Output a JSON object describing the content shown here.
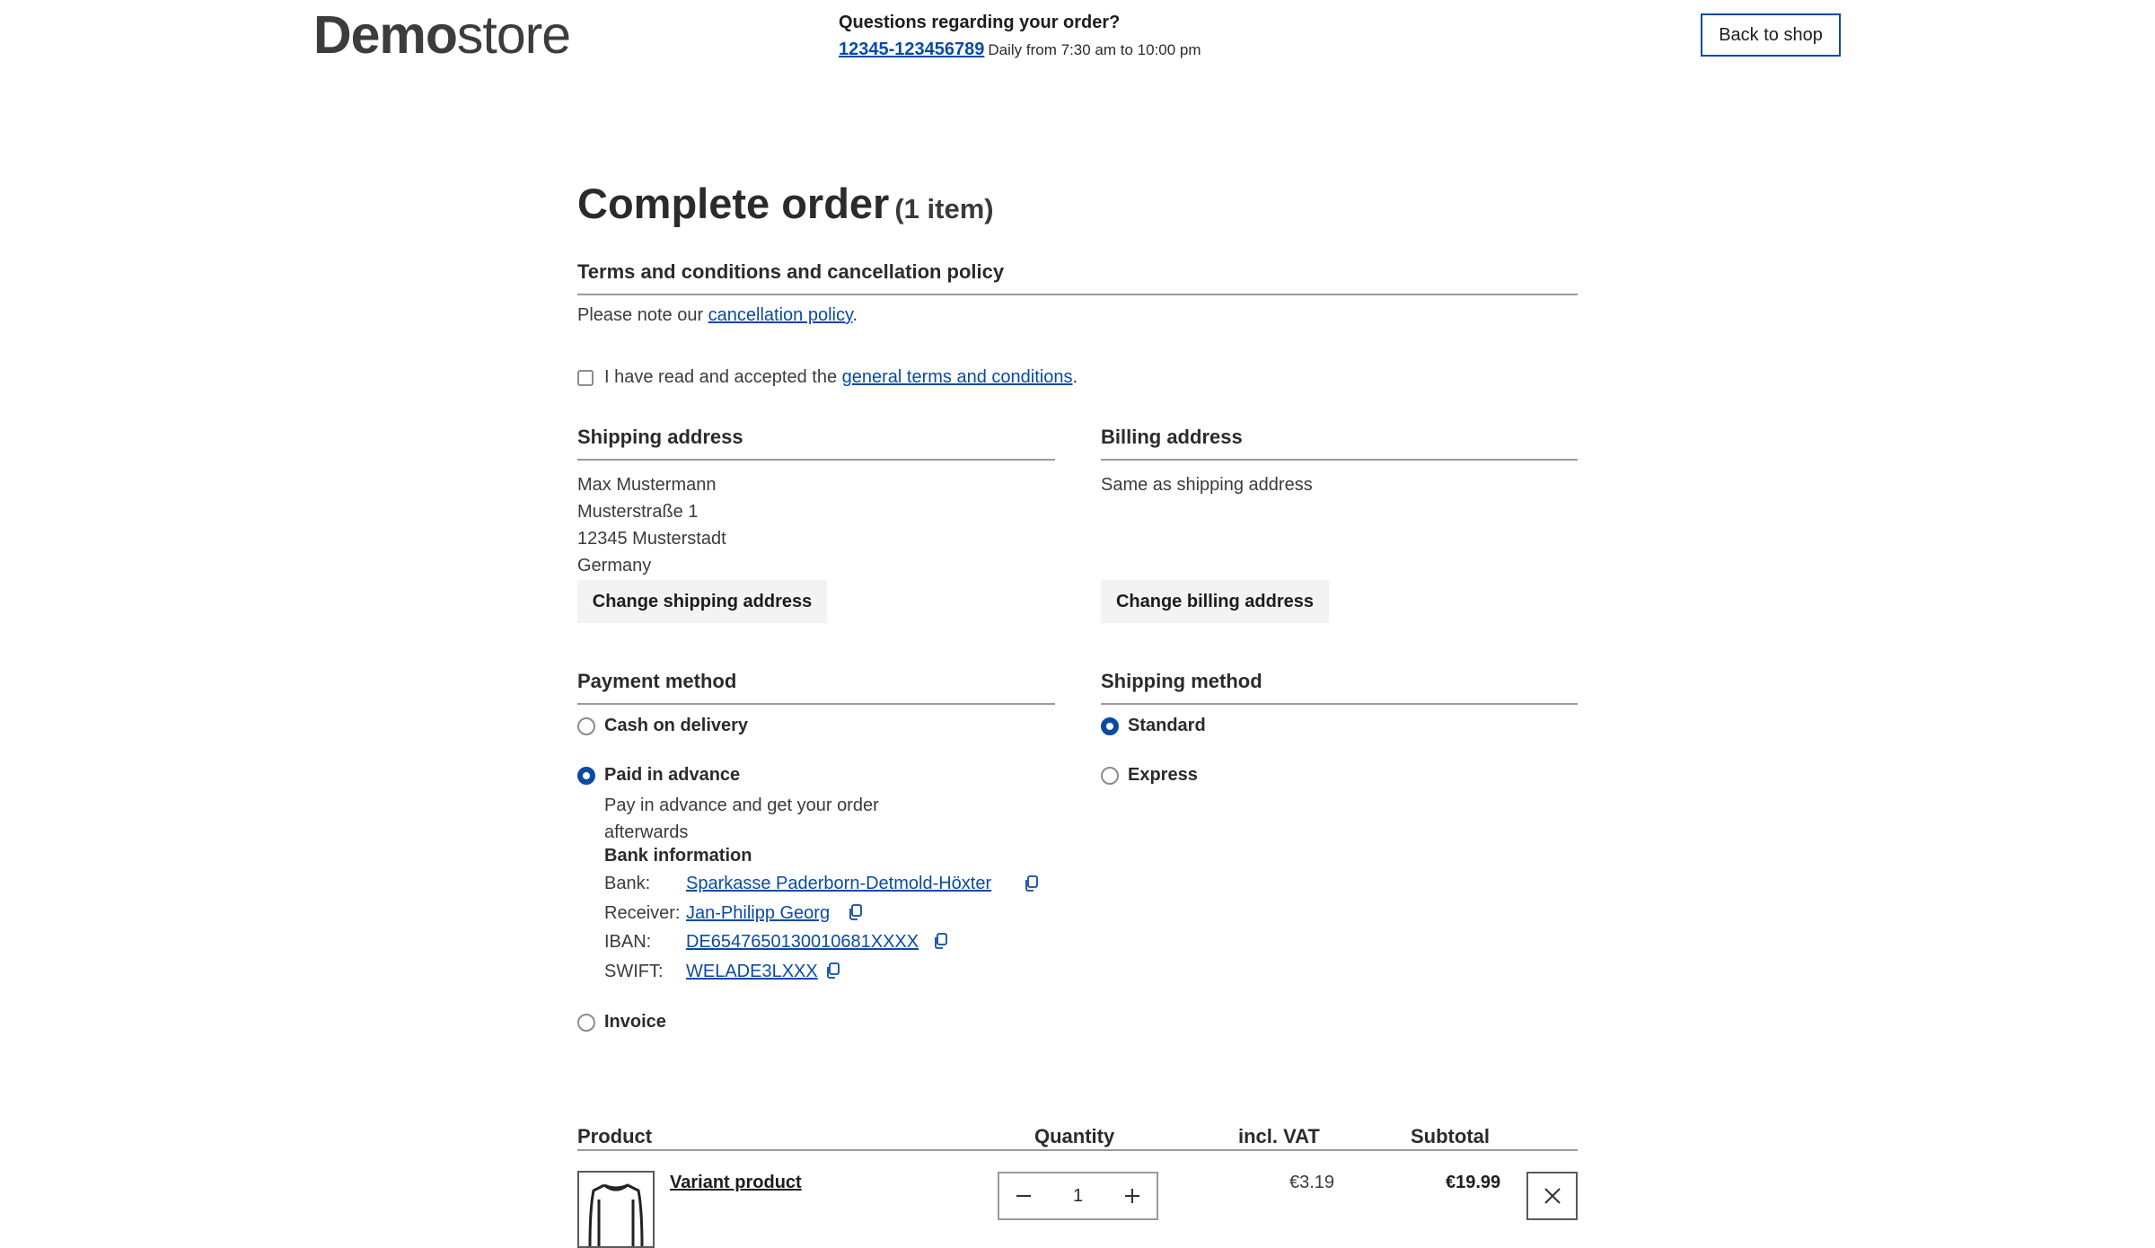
{
  "header": {
    "logo_bold": "Demo",
    "logo_light": "store",
    "help_title": "Questions regarding your order?",
    "phone": "12345-123456789",
    "hours": "Daily from 7:30 am to 10:00 pm",
    "back_label": "Back to shop"
  },
  "page": {
    "title": "Complete order",
    "item_count": "(1 item)"
  },
  "terms": {
    "heading": "Terms and conditions and cancellation policy",
    "note_prefix": "Please note our ",
    "note_link": "cancellation policy",
    "note_suffix": ".",
    "checkbox_prefix": "I have read and accepted the ",
    "checkbox_link": "general terms and conditions",
    "checkbox_suffix": ".",
    "accepted": false
  },
  "shipping_address": {
    "heading": "Shipping address",
    "lines": [
      "Max Mustermann",
      "Musterstraße 1",
      "12345 Musterstadt",
      "Germany"
    ],
    "button": "Change shipping address"
  },
  "billing_address": {
    "heading": "Billing address",
    "text": "Same as shipping address",
    "button": "Change billing address"
  },
  "payment": {
    "heading": "Payment method",
    "options": [
      {
        "label": "Cash on delivery",
        "checked": false
      },
      {
        "label": "Paid in advance",
        "checked": true
      },
      {
        "label": "Invoice",
        "checked": false
      }
    ],
    "description_line1": "Pay in advance and get your order",
    "description_line2": "afterwards",
    "bank_heading": "Bank information",
    "bank": [
      {
        "label": "Bank:",
        "value": "Sparkasse Paderborn-Detmold-Höxter"
      },
      {
        "label": "Receiver:",
        "value": "Jan-Philipp Georg"
      },
      {
        "label": "IBAN:",
        "value": "DE6547650130010681XXXX"
      },
      {
        "label": "SWIFT:",
        "value": "WELADE3LXXX"
      }
    ]
  },
  "shipping_method": {
    "heading": "Shipping method",
    "options": [
      {
        "label": "Standard",
        "checked": true
      },
      {
        "label": "Express",
        "checked": false
      }
    ]
  },
  "cart": {
    "headers": {
      "product": "Product",
      "quantity": "Quantity",
      "vat": "incl. VAT",
      "subtotal": "Subtotal"
    },
    "items": [
      {
        "name": "Variant product",
        "quantity": "1",
        "vat": "€3.19",
        "subtotal": "€19.99"
      }
    ]
  },
  "colors": {
    "accent": "#0b4aa2",
    "text": "#2b2b2b",
    "rule": "#9a9a9a",
    "button_bg": "#f3f3f3"
  }
}
